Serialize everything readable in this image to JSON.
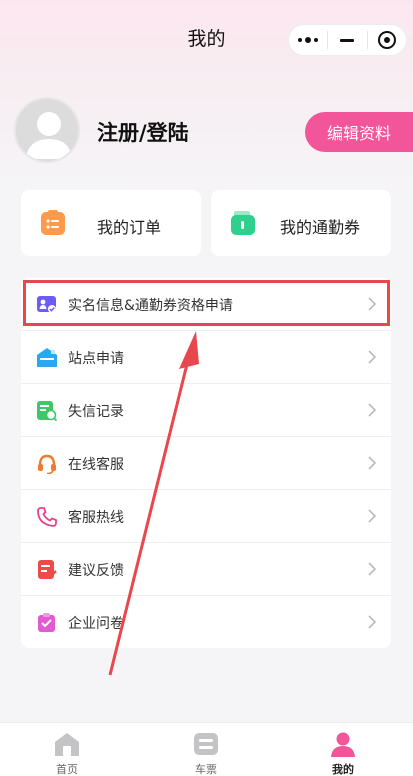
{
  "header": {
    "title": "我的"
  },
  "profile": {
    "username": "注册/登陆",
    "edit_label": "编辑资料"
  },
  "cards": [
    {
      "label": "我的订单",
      "icon": "order-icon",
      "color": "#ff9a4a"
    },
    {
      "label": "我的通勤券",
      "icon": "wallet-icon",
      "color": "#2fcf8e"
    }
  ],
  "menu": {
    "items": [
      {
        "label": "实名信息&通勤券资格申请",
        "icon": "id-card-icon"
      },
      {
        "label": "站点申请",
        "icon": "station-icon"
      },
      {
        "label": "失信记录",
        "icon": "record-icon"
      },
      {
        "label": "在线客服",
        "icon": "headset-icon"
      },
      {
        "label": "客服热线",
        "icon": "phone-icon"
      },
      {
        "label": "建议反馈",
        "icon": "feedback-icon"
      },
      {
        "label": "企业问卷",
        "icon": "survey-icon"
      }
    ]
  },
  "tabbar": {
    "items": [
      {
        "label": "首页",
        "icon": "home-icon"
      },
      {
        "label": "车票",
        "icon": "ticket-icon"
      },
      {
        "label": "我的",
        "icon": "user-icon",
        "active": true
      }
    ]
  },
  "colors": {
    "accent": "#f3559a",
    "highlight": "#e8474d"
  }
}
